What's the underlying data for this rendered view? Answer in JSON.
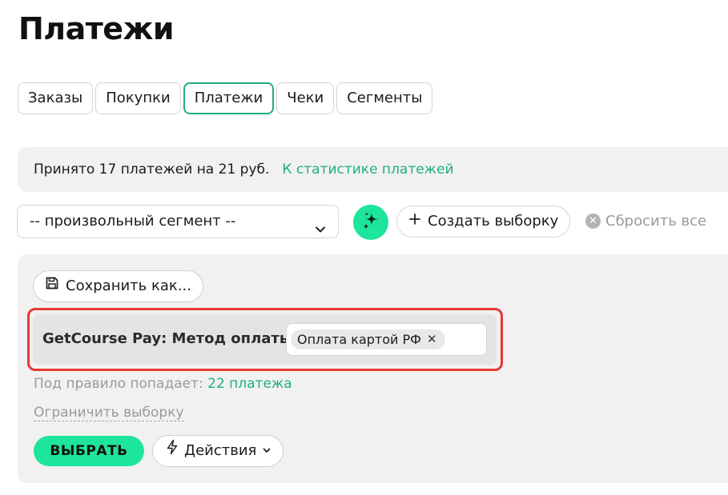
{
  "page": {
    "title": "Платежи"
  },
  "tabs": [
    {
      "label": "Заказы",
      "active": false
    },
    {
      "label": "Покупки",
      "active": false
    },
    {
      "label": "Платежи",
      "active": true
    },
    {
      "label": "Чеки",
      "active": false
    },
    {
      "label": "Сегменты",
      "active": false
    }
  ],
  "stats": {
    "summary": "Принято 17 платежей на 21 руб.",
    "link_label": "К статистике платежей"
  },
  "toolbar": {
    "segment_select_value": "-- произвольный сегмент --",
    "magic_icon": "sparkle-icon",
    "create_button_label": "Создать выборку",
    "reset_label": "Сбросить все"
  },
  "filter": {
    "save_button_label": "Сохранить как...",
    "rule_label": "GetCourse Pay: Метод оплаты",
    "rule_chip": "Оплата картой РФ",
    "count_prefix": "Под правило попадает:",
    "count_link": "22 платежа",
    "limit_link": "Ограничить выборку",
    "select_button_label": "ВЫБРАТЬ",
    "actions_button_label": "Действия"
  },
  "colors": {
    "accent": "#1fae82",
    "primary_button": "#1ee59c",
    "highlight_border": "#e53935",
    "panel_background": "#f1f1f1"
  }
}
